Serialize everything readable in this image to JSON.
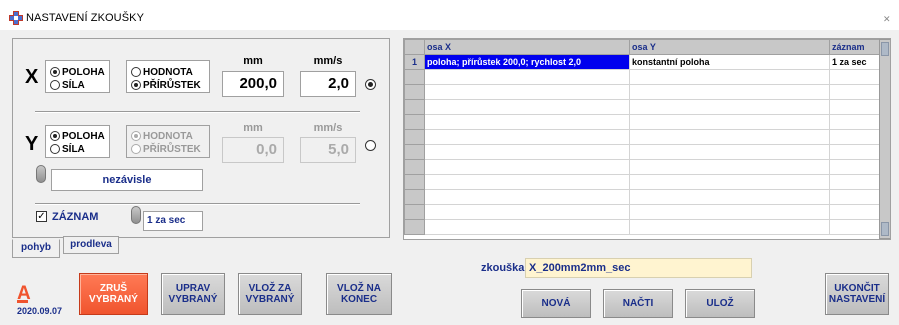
{
  "window": {
    "title": "NASTAVENÍ ZKOUŠKY"
  },
  "panel": {
    "x_axis": {
      "letter": "X",
      "mode_options": [
        "POLOHA",
        "SÍLA"
      ],
      "mode_selected": "POLOHA",
      "type_options": [
        "HODNOTA",
        "PŘÍRŮSTEK"
      ],
      "type_selected": "PŘÍRŮSTEK",
      "mm_header": "mm",
      "mms_header": "mm/s",
      "mm_value": "200,0",
      "mms_value": "2,0",
      "selected": true
    },
    "y_axis": {
      "letter": "Y",
      "mode_options": [
        "POLOHA",
        "SÍLA"
      ],
      "mode_selected": "POLOHA",
      "type_options": [
        "HODNOTA",
        "PŘÍRŮSTEK"
      ],
      "type_selected": "HODNOTA",
      "mm_header": "mm",
      "mms_header": "mm/s",
      "mm_value": "0,0",
      "mms_value": "5,0",
      "selected": false
    },
    "dependency": "nezávisle",
    "record": {
      "label": "ZÁZNAM",
      "checked": true,
      "interval": "1 za sec"
    }
  },
  "tabs": [
    "pohyb",
    "prodleva"
  ],
  "table": {
    "headers": [
      "osa X",
      "osa Y",
      "záznam"
    ],
    "rows": [
      {
        "num": "1",
        "x": "poloha; přírůstek 200,0; rychlost 2,0",
        "y": "konstantní poloha",
        "rec": "1 za sec"
      }
    ],
    "empty_rows": 11
  },
  "test": {
    "label": "zkouška",
    "name": "X_200mm2mm_sec"
  },
  "buttons": {
    "delete": "ZRUŠ VYBRANÝ",
    "edit": "UPRAV VYBRANÝ",
    "insert_before": "VLOŽ ZA VYBRANÝ",
    "append": "VLOŽ NA KONEC",
    "new": "NOVÁ",
    "load": "NAČTI",
    "save": "ULOŽ",
    "finish": "UKONČIT NASTAVENÍ"
  },
  "logo": {
    "letter": "A",
    "date": "2020.09.07"
  },
  "colors": {
    "accent_red": "#f0542e",
    "button_text": "#1a2e8a",
    "selection": "#0000ee",
    "name_field": "#fff4d0"
  }
}
